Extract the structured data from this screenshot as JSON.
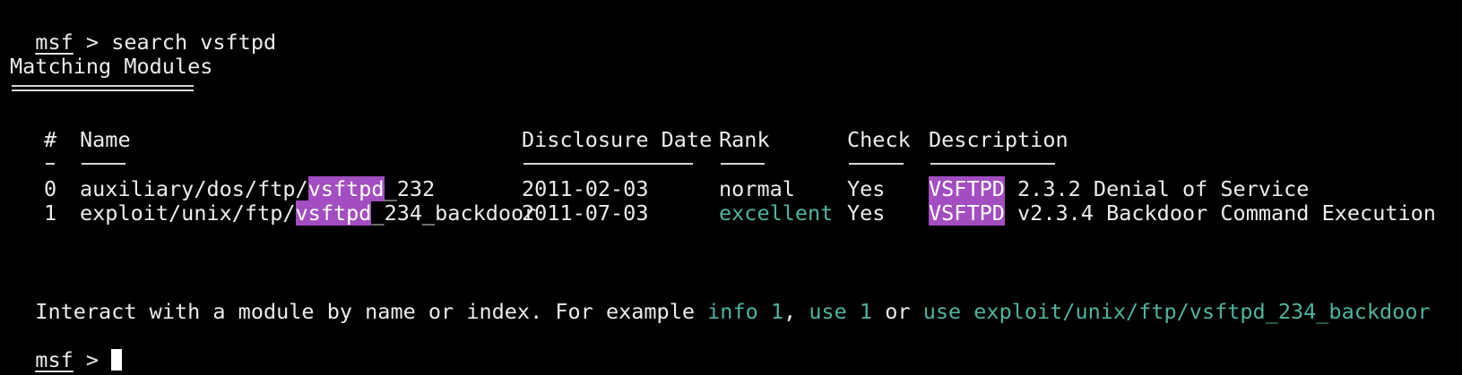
{
  "prompt": "msf",
  "prompt_separator": " > ",
  "command": "search vsftpd",
  "section_title": "Matching Modules",
  "table": {
    "headers": {
      "num": "#",
      "name": "Name",
      "date": "Disclosure Date",
      "rank": "Rank",
      "check": "Check",
      "description": "Description"
    },
    "rows": [
      {
        "num": "0",
        "name_prefix": "auxiliary/dos/ftp/",
        "name_match": "vsftpd",
        "name_suffix": "_232",
        "date": "2011-02-03",
        "rank": "normal",
        "check": "Yes",
        "desc_match": "VSFTPD",
        "desc_rest": " 2.3.2 Denial of Service"
      },
      {
        "num": "1",
        "name_prefix": "exploit/unix/ftp/",
        "name_match": "vsftpd",
        "name_suffix": "_234_backdoor",
        "date": "2011-07-03",
        "rank": "excellent",
        "check": "Yes",
        "desc_match": "VSFTPD",
        "desc_rest": " v2.3.4 Backdoor Command Execution"
      }
    ]
  },
  "hint": {
    "prefix": "Interact with a module by name or index. For example ",
    "cmd1": "info 1",
    "sep1": ", ",
    "cmd2": "use 1",
    "sep2": " or ",
    "cmd3": "use exploit/unix/ftp/vsftpd_234_backdoor"
  },
  "colors": {
    "background": "#000000",
    "text": "#ececec",
    "highlight": "#a34ec0",
    "accent_green": "#4fb39f"
  }
}
